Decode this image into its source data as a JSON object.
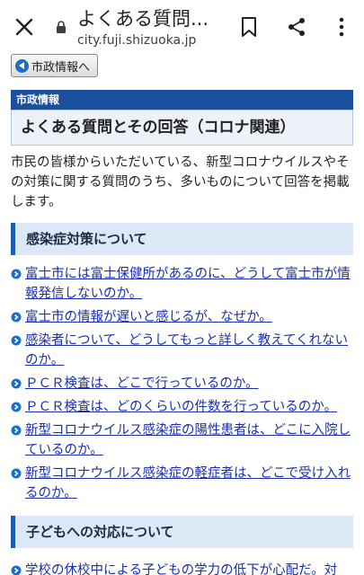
{
  "browser": {
    "page_title": "よくある質問...",
    "url": "city.fuji.shizuoka.jp"
  },
  "nav": {
    "back_label": "市政情報へ"
  },
  "section_label": "市政情報",
  "page_heading": "よくある質問とその回答（コロナ関連）",
  "intro": "市民の皆様からいただいている、新型コロナウイルスやその対策に関する質問のうち、多いものについて回答を掲載します。",
  "categories": [
    {
      "title": "感染症対策について"
    },
    {
      "title": "子どもへの対応について"
    }
  ],
  "faqs": [
    "富士市には富士保健所があるのに、どうして富士市が情報発信しないのか。",
    "富士市の情報が遅いと感じるが、なぜか。",
    "感染者について、どうしてもっと詳しく教えてくれないのか。",
    "ＰＣＲ検査は、どこで行っているのか。",
    "ＰＣＲ検査は、どのくらいの件数を行っているのか。",
    "新型コロナウイルス感染症の陽性患者は、どこに入院しているのか。",
    "新型コロナウイルス感染症の軽症者は、どこで受け入れるのか。"
  ],
  "partial_faq": "学校の休校中による子どもの学力の低下が心配だ。対",
  "colors": {
    "section_bar": "#1a4f9c",
    "link": "#1a2fa8",
    "category_bg": "#dce8f5",
    "category_accent": "#1a5fb4"
  }
}
